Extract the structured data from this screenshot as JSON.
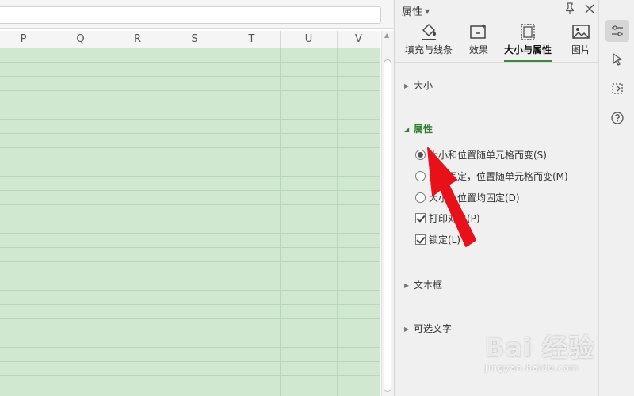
{
  "sheet": {
    "columns": [
      "P",
      "Q",
      "R",
      "S",
      "T",
      "U",
      "V"
    ]
  },
  "pane": {
    "title": "属性",
    "tabs": [
      {
        "label": "填充与线条",
        "icon": "fill-bucket-icon"
      },
      {
        "label": "效果",
        "icon": "effects-icon"
      },
      {
        "label": "大小与属性",
        "icon": "size-properties-icon",
        "active": true
      },
      {
        "label": "图片",
        "icon": "picture-icon"
      }
    ],
    "sections": {
      "size": "大小",
      "properties": "属性",
      "textbox": "文本框",
      "alt_text": "可选文字"
    },
    "options": {
      "move_and_size": "大小和位置随单元格而变(S)",
      "move_no_size": "大小固定，位置随单元格而变(M)",
      "no_move_no_size": "大小、位置均固定(D)",
      "print_object": "打印对象(P)",
      "locked": "锁定(L)"
    },
    "selected_option": "move_and_size",
    "print_object_checked": true,
    "locked_checked": true
  },
  "right_toolbar": [
    {
      "icon": "property-sliders-icon",
      "active": true
    },
    {
      "icon": "select-cursor-icon"
    },
    {
      "icon": "resize-icon"
    },
    {
      "icon": "help-icon"
    }
  ],
  "watermark": {
    "text": "Bai 经验",
    "url": "jingyan.baidu.com"
  },
  "colors": {
    "accent": "#2e7d32",
    "cell_fill": "#cfe8cf",
    "arrow": "#e8111a"
  }
}
